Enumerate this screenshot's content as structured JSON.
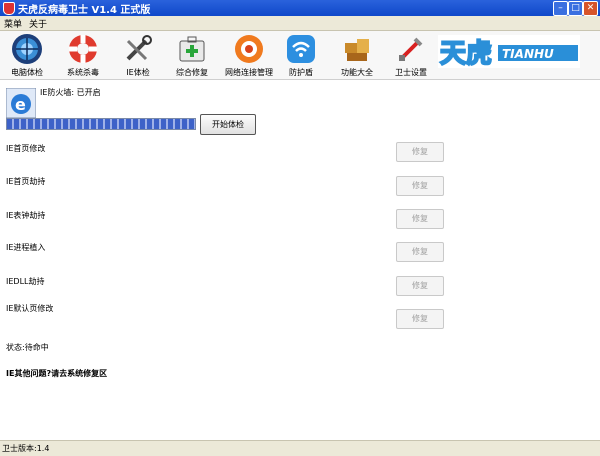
{
  "window": {
    "title": "天虎反病毒卫士 V1.4 正式版"
  },
  "menu": [
    "菜单",
    "关于"
  ],
  "toolbar": {
    "items": [
      {
        "label": "电脑体检",
        "icon": "globe-scan-icon"
      },
      {
        "label": "系统杀毒",
        "icon": "lifebuoy-icon"
      },
      {
        "label": "IE体检",
        "icon": "tools-icon"
      },
      {
        "label": "综合修复",
        "icon": "medical-kit-icon"
      },
      {
        "label": "网络连接管理",
        "icon": "network-icon"
      },
      {
        "label": "防护盾",
        "icon": "wifi-shield-icon"
      },
      {
        "label": "功能大全",
        "icon": "boxes-icon"
      },
      {
        "label": "卫士设置",
        "icon": "settings-icon"
      }
    ],
    "logo_cn": "天虎",
    "logo_en": "TIANHU"
  },
  "main": {
    "firewall_status": "IE防火墙: 已开启",
    "scan_button": "开始体检",
    "progress": 1.0,
    "rows": [
      {
        "label": "IE首页修改",
        "button": "修复"
      },
      {
        "label": "IE首页劫持",
        "button": "修复"
      },
      {
        "label": "IE表钟劫持",
        "button": "修复"
      },
      {
        "label": "IE进程植入",
        "button": "修复"
      },
      {
        "label": "IEDLL劫持",
        "button": "修复"
      },
      {
        "label": "IE默认页修改",
        "button": "修复"
      }
    ],
    "status": "状态:待命中",
    "other_issue": "IE其他问题?请去系统修复区"
  },
  "statusbar": {
    "version": "卫士版本:1.4"
  },
  "colors": {
    "titlebar": "#1a55d6",
    "accent": "#3d62c8",
    "logo": "#2a8fd8"
  }
}
